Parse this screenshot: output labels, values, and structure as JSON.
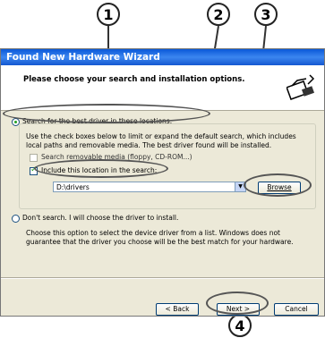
{
  "callouts": [
    "1",
    "2",
    "3",
    "4"
  ],
  "window": {
    "title": "Found New Hardware Wizard",
    "header_text": "Please choose your search and installation options."
  },
  "options": {
    "search_label": "Search for the best driver in these locations.",
    "search_desc": "Use the check boxes below to limit or expand the default search, which includes local paths and removable media. The best driver found will be installed.",
    "removable_label": "Search removable media (floppy, CD-ROM...)",
    "include_label": "Include this location in the search:",
    "path_value": "D:\\drivers",
    "browse_label": "Browse",
    "dont_search_label": "Don't search. I will choose the driver to install.",
    "dont_search_desc": "Choose this option to select the device driver from a list.  Windows does not guarantee that the driver you choose will be the best match for your hardware."
  },
  "buttons": {
    "back": "< Back",
    "next": "Next >",
    "cancel": "Cancel"
  }
}
